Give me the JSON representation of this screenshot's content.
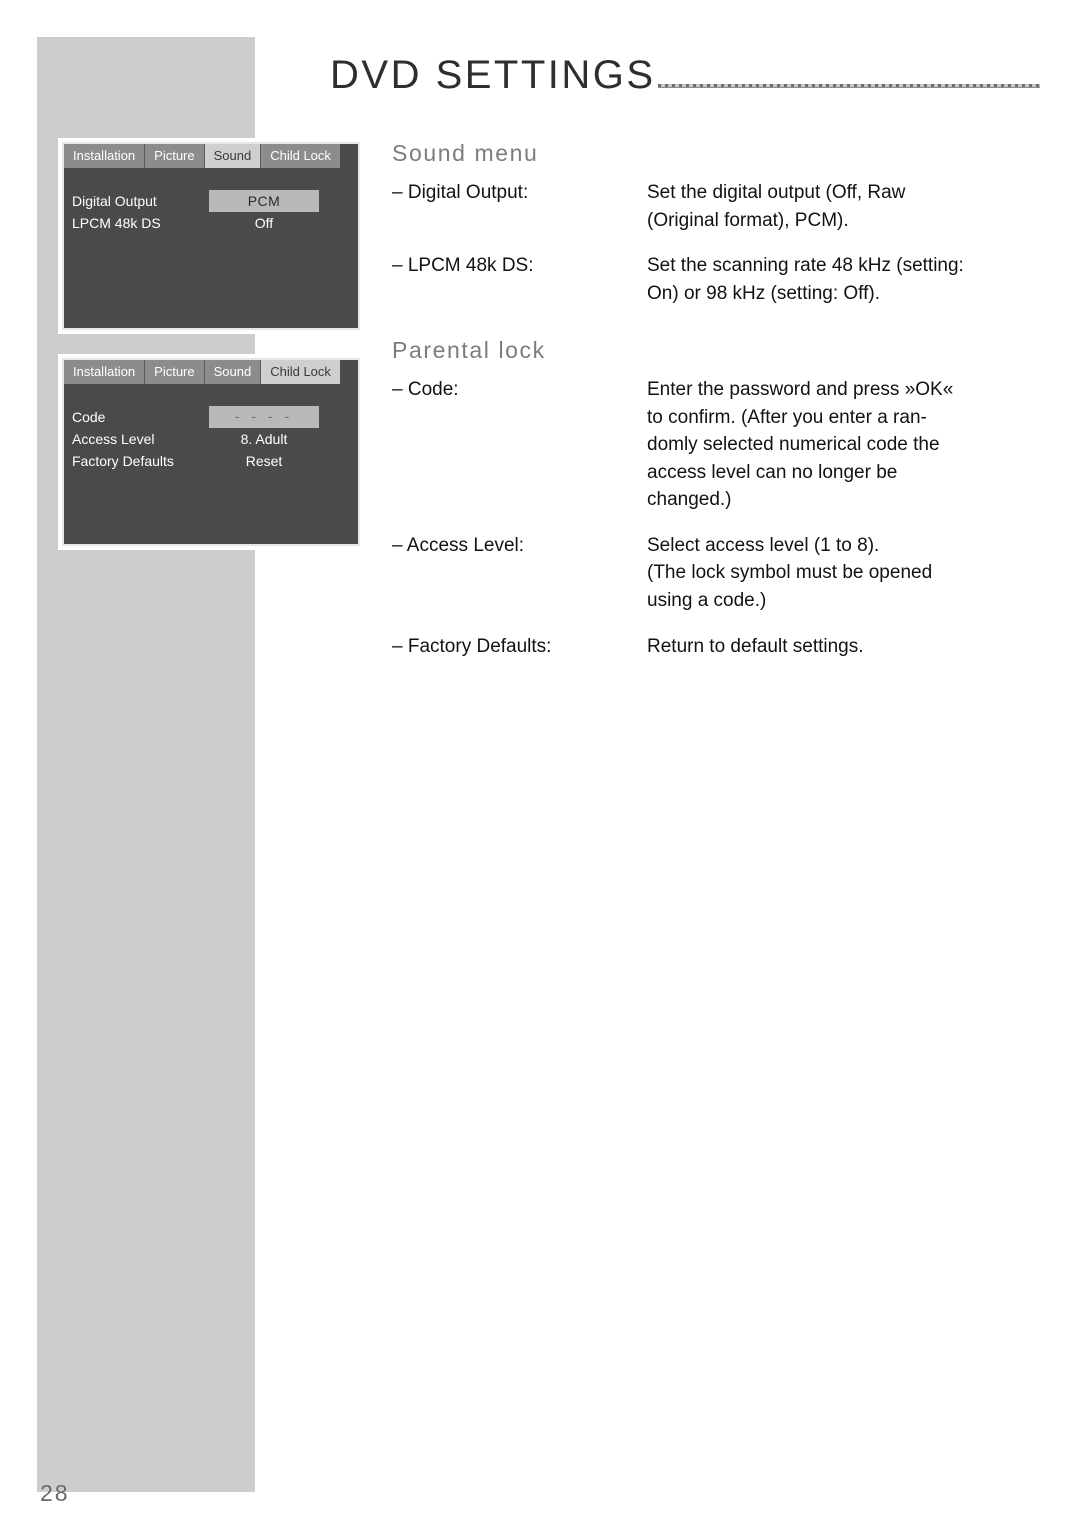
{
  "page": {
    "number": "28",
    "header_title": "DVD SETTINGS"
  },
  "osd_screens": [
    {
      "name": "sound-menu-screen",
      "tabs": [
        {
          "label": "Installation",
          "active": false
        },
        {
          "label": "Picture",
          "active": false
        },
        {
          "label": "Sound",
          "active": true
        },
        {
          "label": "Child Lock",
          "active": false
        }
      ],
      "rows": [
        {
          "label": "Digital Output",
          "value": "PCM",
          "style": "selected"
        },
        {
          "label": "LPCM 48k DS",
          "value": "Off",
          "style": "plain"
        }
      ]
    },
    {
      "name": "child-lock-screen",
      "tabs": [
        {
          "label": "Installation",
          "active": false
        },
        {
          "label": "Picture",
          "active": false
        },
        {
          "label": "Sound",
          "active": false
        },
        {
          "label": "Child Lock",
          "active": true
        }
      ],
      "rows": [
        {
          "label": "Code",
          "value": "- - - -",
          "style": "dashes"
        },
        {
          "label": "Access Level",
          "value": "8. Adult",
          "style": "plain"
        },
        {
          "label": "Factory Defaults",
          "value": "Reset",
          "style": "plain"
        }
      ]
    }
  ],
  "sections": [
    {
      "title": "Sound menu",
      "entries": [
        {
          "term": "– Digital Output:",
          "lines": [
            "Set the digital output (Off, Raw",
            "(Original format), PCM)."
          ]
        },
        {
          "term": "– LPCM 48k DS:",
          "lines": [
            "Set the scanning rate 48 kHz (setting:",
            "On) or 98 kHz (setting: Off)."
          ]
        }
      ]
    },
    {
      "title": "Parental lock",
      "entries": [
        {
          "term": "– Code:",
          "lines": [
            "Enter the password and press »OK«",
            "to confirm. (After you enter a ran-",
            "domly selected numerical code the",
            "access level can no longer be",
            "changed.)"
          ]
        },
        {
          "term": "– Access Level:",
          "lines": [
            "Select access level (1 to 8).",
            "(The lock symbol must be opened",
            "using a code.)"
          ]
        },
        {
          "term": "– Factory Defaults:",
          "lines": [
            "Return to default settings."
          ]
        }
      ]
    }
  ]
}
